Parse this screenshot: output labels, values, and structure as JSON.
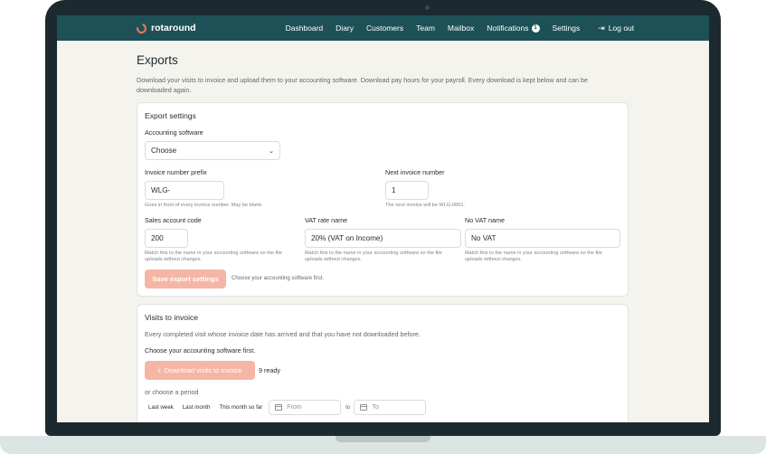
{
  "app": {
    "brand": "rotaround",
    "colors": {
      "topbar": "#1d5157",
      "accent": "#f07b55",
      "button_disabled": "#f6b6a5",
      "page_bg": "#f4f3ee"
    }
  },
  "nav": {
    "items": [
      {
        "label": "Dashboard"
      },
      {
        "label": "Diary"
      },
      {
        "label": "Customers"
      },
      {
        "label": "Team"
      },
      {
        "label": "Mailbox"
      },
      {
        "label": "Notifications",
        "badge": "1"
      },
      {
        "label": "Settings"
      }
    ],
    "logout": {
      "label": "Log out",
      "icon": "logout-icon"
    }
  },
  "page": {
    "title": "Exports",
    "description": "Download your visits to invoice and upload them to your accounting software. Download pay hours for your payroll. Every download is kept below and can be downloaded again."
  },
  "export_settings": {
    "title": "Export settings",
    "accounting_software": {
      "label": "Accounting software",
      "value": "Choose"
    },
    "invoice_prefix": {
      "label": "Invoice number prefix",
      "value": "WLG-",
      "help": "Goes in front of every invoice number. May be blank."
    },
    "next_invoice": {
      "label": "Next invoice number",
      "value": "1",
      "help": "The next invoice will be WLG-0001."
    },
    "sales_account": {
      "label": "Sales account code",
      "value": "200",
      "help": "Match this to the name in your accounting software so the file uploads without changes."
    },
    "vat_rate": {
      "label": "VAT rate name",
      "value": "20% (VAT on Income)",
      "help": "Match this to the name in your accounting software so the file uploads without changes."
    },
    "no_vat": {
      "label": "No VAT name",
      "value": "No VAT",
      "help": "Match this to the name in your accounting software so the file uploads without changes."
    },
    "save_button": "Save export settings",
    "save_note": "Choose your accounting software first."
  },
  "visits": {
    "title": "Visits to invoice",
    "description": "Every completed visit whose invoice date has arrived and that you have not downloaded before.",
    "warning": "Choose your accounting software first.",
    "download_button": "Download visits to invoice",
    "ready_count": "9 ready",
    "period_label": "or choose a period",
    "periods": [
      "Last week",
      "Last month",
      "This month so far"
    ],
    "from_placeholder": "From",
    "to_label": "to",
    "to_placeholder": "To"
  }
}
